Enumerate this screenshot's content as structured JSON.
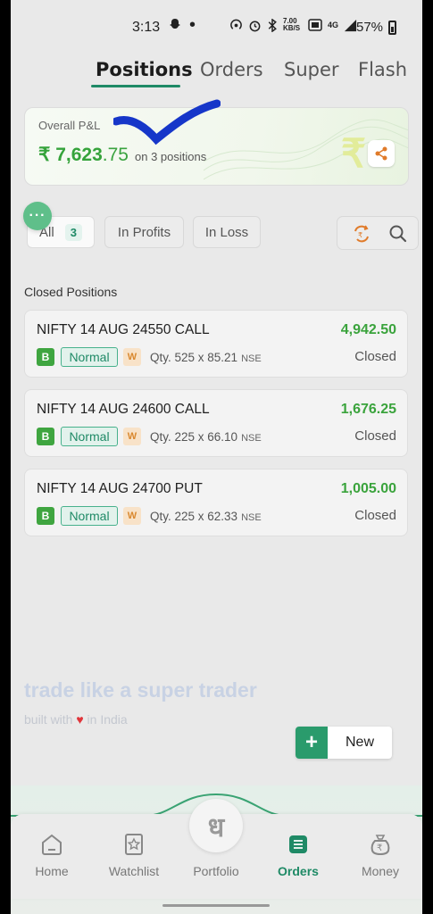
{
  "status_bar": {
    "time": "3:13",
    "speed": "7.00 KB/S",
    "network": "4G",
    "battery": "57%"
  },
  "tabs": [
    {
      "label": "Positions",
      "active": true
    },
    {
      "label": "Orders",
      "active": false
    },
    {
      "label": "Super",
      "active": false
    },
    {
      "label": "Flash",
      "active": false
    }
  ],
  "pnl": {
    "label": "Overall P&L",
    "currency": "₹",
    "value_int": "7,623",
    "value_dec": ".75",
    "sub": "on 3 positions"
  },
  "filters": {
    "all_label": "All",
    "all_count": "3",
    "profits_label": "In Profits",
    "loss_label": "In Loss"
  },
  "section_title": "Closed Positions",
  "positions": [
    {
      "name": "NIFTY 14 AUG 24550 CALL",
      "pnl": "4,942.50",
      "side": "B",
      "product": "Normal",
      "tag": "W",
      "qty": "Qty.  525 x 85.21",
      "exchange": "NSE",
      "status": "Closed"
    },
    {
      "name": "NIFTY 14 AUG 24600 CALL",
      "pnl": "1,676.25",
      "side": "B",
      "product": "Normal",
      "tag": "W",
      "qty": "Qty.  225 x 66.10",
      "exchange": "NSE",
      "status": "Closed"
    },
    {
      "name": "NIFTY 14 AUG 24700 PUT",
      "pnl": "1,005.00",
      "side": "B",
      "product": "Normal",
      "tag": "W",
      "qty": "Qty.  225 x 62.33",
      "exchange": "NSE",
      "status": "Closed"
    }
  ],
  "tagline": {
    "title": "trade like a super trader",
    "sub_before": "built with ",
    "sub_after": " in India"
  },
  "new_button": {
    "label": "New"
  },
  "nav": [
    {
      "label": "Home",
      "icon": "home-icon"
    },
    {
      "label": "Watchlist",
      "icon": "watchlist-icon"
    },
    {
      "label": "Portfolio",
      "icon": "portfolio-icon"
    },
    {
      "label": "Orders",
      "icon": "orders-icon",
      "active": true
    },
    {
      "label": "Money",
      "icon": "money-icon"
    }
  ],
  "portfolio_glyph": "ध",
  "colors": {
    "accent": "#1f8a66",
    "profit": "#3aa33c",
    "background": "#e9e9e9"
  }
}
